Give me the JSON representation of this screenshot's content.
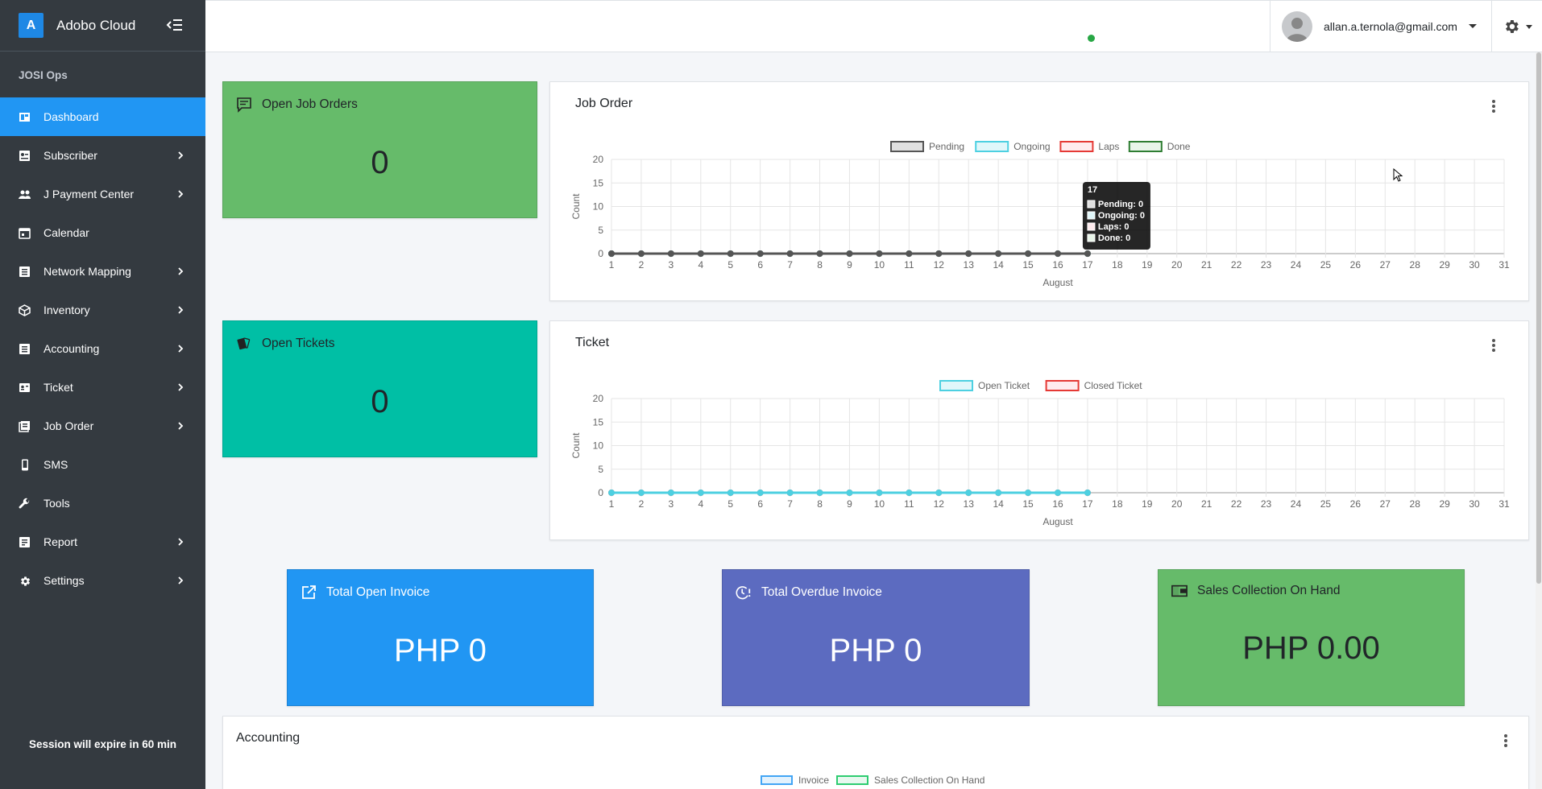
{
  "app": {
    "brand_letter": "A",
    "brand_name": "Adobo Cloud",
    "org_label": "JOSI Ops",
    "session_text": "Session will expire in 60 min"
  },
  "sidebar": {
    "items": [
      {
        "label": "Dashboard",
        "icon": "dashboard-icon",
        "active": true,
        "has_children": false
      },
      {
        "label": "Subscriber",
        "icon": "subscriber-icon",
        "active": false,
        "has_children": true
      },
      {
        "label": "J Payment Center",
        "icon": "users-icon",
        "active": false,
        "has_children": true
      },
      {
        "label": "Calendar",
        "icon": "calendar-icon",
        "active": false,
        "has_children": false
      },
      {
        "label": "Network Mapping",
        "icon": "list-icon",
        "active": false,
        "has_children": true
      },
      {
        "label": "Inventory",
        "icon": "cube-icon",
        "active": false,
        "has_children": true
      },
      {
        "label": "Accounting",
        "icon": "list-icon",
        "active": false,
        "has_children": true
      },
      {
        "label": "Ticket",
        "icon": "ticket-icon",
        "active": false,
        "has_children": true
      },
      {
        "label": "Job Order",
        "icon": "job-order-icon",
        "active": false,
        "has_children": true
      },
      {
        "label": "SMS",
        "icon": "mobile-icon",
        "active": false,
        "has_children": false
      },
      {
        "label": "Tools",
        "icon": "wrench-icon",
        "active": false,
        "has_children": false
      },
      {
        "label": "Report",
        "icon": "report-icon",
        "active": false,
        "has_children": true
      },
      {
        "label": "Settings",
        "icon": "gear-icon",
        "active": false,
        "has_children": true
      }
    ]
  },
  "header": {
    "user_email": "allan.a.ternola@gmail.com"
  },
  "cards": {
    "open_job_orders": {
      "label": "Open Job Orders",
      "value": "0",
      "color": "#66bb6a"
    },
    "open_tickets": {
      "label": "Open Tickets",
      "value": "0",
      "color": "#00bfa5"
    },
    "total_open_invoice": {
      "label": "Total Open Invoice",
      "value": "PHP 0",
      "color": "#2196f3"
    },
    "total_overdue_invoice": {
      "label": "Total Overdue Invoice",
      "value": "PHP 0",
      "color": "#5c6bc0"
    },
    "sales_collection": {
      "label": "Sales Collection On Hand",
      "value": "PHP 0.00",
      "color": "#66bb6a"
    }
  },
  "accounting": {
    "title": "Accounting",
    "legend": [
      "Invoice",
      "Sales Collection On Hand"
    ]
  },
  "chart_data": [
    {
      "type": "line",
      "title": "Job Order",
      "xlabel": "August",
      "ylabel": "Count",
      "ylim": [
        0,
        20
      ],
      "yticks": [
        "0",
        "5",
        "10",
        "15",
        "20"
      ],
      "categories": [
        "1",
        "2",
        "3",
        "4",
        "5",
        "6",
        "7",
        "8",
        "9",
        "10",
        "11",
        "12",
        "13",
        "14",
        "15",
        "16",
        "17",
        "18",
        "19",
        "20",
        "21",
        "22",
        "23",
        "24",
        "25",
        "26",
        "27",
        "28",
        "29",
        "30",
        "31"
      ],
      "legend_placement": "top-center",
      "grid": true,
      "series": [
        {
          "name": "Pending",
          "color": "#555555",
          "fill": "#e0e0e0",
          "values": [
            0,
            0,
            0,
            0,
            0,
            0,
            0,
            0,
            0,
            0,
            0,
            0,
            0,
            0,
            0,
            0,
            0
          ]
        },
        {
          "name": "Ongoing",
          "color": "#4dd0e1",
          "fill": "#e0f7fa",
          "values": [
            0,
            0,
            0,
            0,
            0,
            0,
            0,
            0,
            0,
            0,
            0,
            0,
            0,
            0,
            0,
            0,
            0
          ]
        },
        {
          "name": "Laps",
          "color": "#e53935",
          "fill": "#ffebee",
          "values": [
            0,
            0,
            0,
            0,
            0,
            0,
            0,
            0,
            0,
            0,
            0,
            0,
            0,
            0,
            0,
            0,
            0
          ]
        },
        {
          "name": "Done",
          "color": "#2e7d32",
          "fill": "#e8f5e9",
          "values": [
            0,
            0,
            0,
            0,
            0,
            0,
            0,
            0,
            0,
            0,
            0,
            0,
            0,
            0,
            0,
            0,
            0
          ]
        }
      ],
      "tooltip": {
        "title": "17",
        "lines": [
          "Pending: 0",
          "Ongoing: 0",
          "Laps: 0",
          "Done: 0"
        ],
        "point_index": 16
      }
    },
    {
      "type": "line",
      "title": "Ticket",
      "xlabel": "August",
      "ylabel": "Count",
      "ylim": [
        0,
        20
      ],
      "yticks": [
        "0",
        "5",
        "10",
        "15",
        "20"
      ],
      "categories": [
        "1",
        "2",
        "3",
        "4",
        "5",
        "6",
        "7",
        "8",
        "9",
        "10",
        "11",
        "12",
        "13",
        "14",
        "15",
        "16",
        "17",
        "18",
        "19",
        "20",
        "21",
        "22",
        "23",
        "24",
        "25",
        "26",
        "27",
        "28",
        "29",
        "30",
        "31"
      ],
      "legend_placement": "top-center",
      "grid": true,
      "series": [
        {
          "name": "Open Ticket",
          "color": "#4dd0e1",
          "fill": "#e0f7fa",
          "values": [
            0,
            0,
            0,
            0,
            0,
            0,
            0,
            0,
            0,
            0,
            0,
            0,
            0,
            0,
            0,
            0,
            0
          ]
        },
        {
          "name": "Closed Ticket",
          "color": "#e53935",
          "fill": "#ffebee",
          "values": [
            0,
            0,
            0,
            0,
            0,
            0,
            0,
            0,
            0,
            0,
            0,
            0,
            0,
            0,
            0,
            0,
            0
          ]
        }
      ]
    }
  ]
}
